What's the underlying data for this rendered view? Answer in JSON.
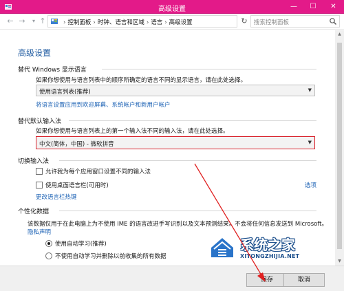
{
  "window": {
    "title": "高级设置"
  },
  "navigation": {
    "breadcrumbs": [
      "控制面板",
      "时钟、语言和区域",
      "语言",
      "高级设置"
    ],
    "search_placeholder": "搜索控制面板"
  },
  "page": {
    "title": "高级设置",
    "display_language": {
      "heading": "替代 Windows 显示语言",
      "description": "如果你想使用与语言列表中的顺序所确定的语言不同的显示语言，请在此处选择。",
      "selected": "使用语言列表(推荐)",
      "link": "将语言设置应用到欢迎屏幕、系统帐户和新用户帐户"
    },
    "input_method": {
      "heading": "替代默认输入法",
      "description": "如果你想使用与语言列表上的第一个输入法不同的输入法，请在此处选择。",
      "selected": "中文(简体，中国) - 微软拼音"
    },
    "switching": {
      "heading": "切换输入法",
      "option1": "允许我为每个应用窗口设置不同的输入法",
      "option2": "使用桌面语言栏(可用时)",
      "options_link": "选项",
      "hotkey_link": "更改语言栏热键"
    },
    "personalization": {
      "heading": "个性化数据",
      "description": "该数据仅用于在此电脑上为不使用 IME 的语言改进手写识别以及文本预测结果。不会将任何信息发送到 Microsoft。",
      "privacy_link": "隐私声明",
      "radio1": "使用自动学习(推荐)",
      "radio2": "不使用自动学习并删除以前收集的所有数据"
    }
  },
  "footer": {
    "save": "保存",
    "cancel": "取消"
  },
  "watermark": {
    "brand": "系统之家",
    "url": "XITONGZHIJIA.NET"
  },
  "colors": {
    "title_bar": "#e31a89",
    "heading": "#1e5aa0",
    "link": "#1e63b5",
    "highlight": "#d9232d"
  }
}
